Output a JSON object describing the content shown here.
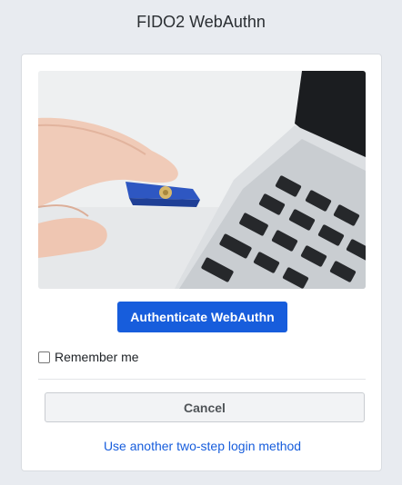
{
  "page": {
    "title": "FIDO2 WebAuthn"
  },
  "hero": {
    "icon": "security-key-photo"
  },
  "actions": {
    "authenticate_label": "Authenticate WebAuthn",
    "cancel_label": "Cancel",
    "alt_method_label": "Use another two-step login method"
  },
  "remember": {
    "label": "Remember me",
    "checked": false
  },
  "colors": {
    "background": "#e8ebf0",
    "primary": "#175ddc",
    "card": "#ffffff"
  }
}
